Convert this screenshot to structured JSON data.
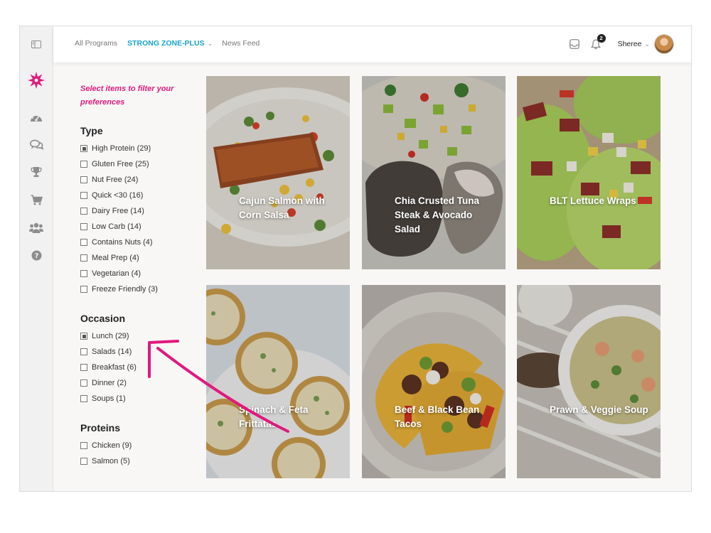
{
  "topbar": {
    "crumbs": [
      "All Programs",
      "STRONG ZONE-PLUS",
      "News Feed"
    ],
    "notification_count": "2",
    "user_name": "Sheree"
  },
  "rail_icons": [
    "sidebar-toggle-icon",
    "brand-logo-icon",
    "dashboard-gauge-icon",
    "chat-bubbles-icon",
    "trophy-icon",
    "cart-icon",
    "users-icon",
    "help-icon"
  ],
  "filters": {
    "hint": "Select items to filter your preferences",
    "groups": [
      {
        "title": "Type",
        "options": [
          {
            "label": "High Protein (29)",
            "checked": true
          },
          {
            "label": "Gluten Free (25)",
            "checked": false
          },
          {
            "label": "Nut Free (24)",
            "checked": false
          },
          {
            "label": "Quick <30 (16)",
            "checked": false
          },
          {
            "label": "Dairy Free (14)",
            "checked": false
          },
          {
            "label": "Low Carb (14)",
            "checked": false
          },
          {
            "label": "Contains Nuts (4)",
            "checked": false
          },
          {
            "label": "Meal Prep (4)",
            "checked": false
          },
          {
            "label": "Vegetarian (4)",
            "checked": false
          },
          {
            "label": "Freeze Friendly (3)",
            "checked": false
          }
        ]
      },
      {
        "title": "Occasion",
        "options": [
          {
            "label": "Lunch (29)",
            "checked": true
          },
          {
            "label": "Salads (14)",
            "checked": false
          },
          {
            "label": "Breakfast (6)",
            "checked": false
          },
          {
            "label": "Dinner (2)",
            "checked": false
          },
          {
            "label": "Soups (1)",
            "checked": false
          }
        ]
      },
      {
        "title": "Proteins",
        "options": [
          {
            "label": "Chicken (9)",
            "checked": false
          },
          {
            "label": "Salmon (5)",
            "checked": false
          }
        ]
      }
    ]
  },
  "recipes": [
    {
      "title": "Cajun Salmon with Corn Salsa"
    },
    {
      "title": "Chia Crusted Tuna Steak & Avocado Salad"
    },
    {
      "title": "BLT Lettuce Wraps"
    },
    {
      "title": "Spinach & Feta Frittatas"
    },
    {
      "title": "Beef & Black Bean Tacos"
    },
    {
      "title": "Prawn & Veggie Soup"
    }
  ],
  "colors": {
    "accent": "#19a3c9",
    "brand_pink": "#e0197d"
  }
}
